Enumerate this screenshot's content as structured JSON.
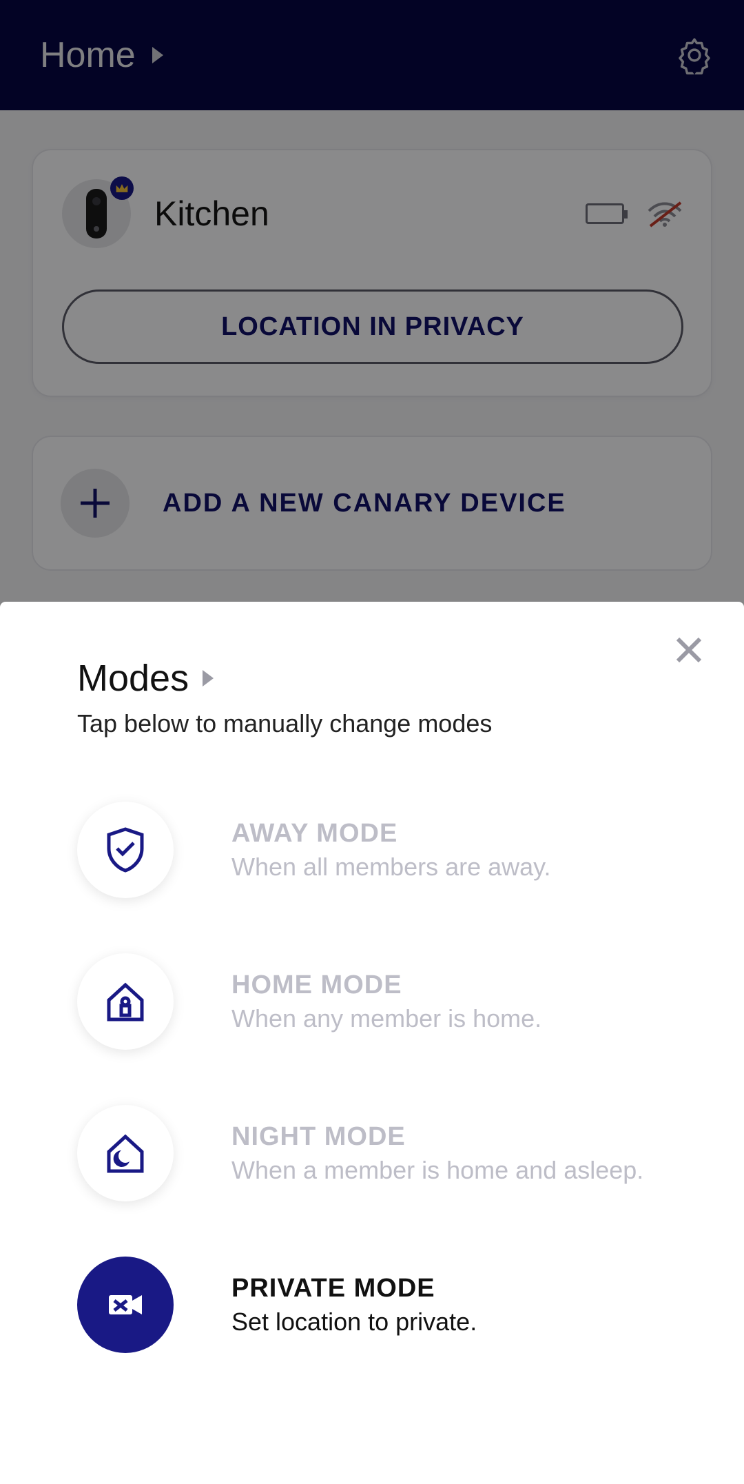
{
  "navbar": {
    "title": "Home"
  },
  "device_card": {
    "name": "Kitchen",
    "button_label": "LOCATION IN PRIVACY"
  },
  "add_card": {
    "label": "ADD A NEW CANARY DEVICE"
  },
  "sheet": {
    "title": "Modes",
    "subtitle": "Tap below to manually change modes",
    "modes": [
      {
        "label": "AWAY MODE",
        "desc": "When all members are away."
      },
      {
        "label": "HOME MODE",
        "desc": "When any member is home."
      },
      {
        "label": "NIGHT MODE",
        "desc": "When a member is home and asleep."
      },
      {
        "label": "PRIVATE MODE",
        "desc": "Set location to private."
      }
    ],
    "active_index": 3
  }
}
